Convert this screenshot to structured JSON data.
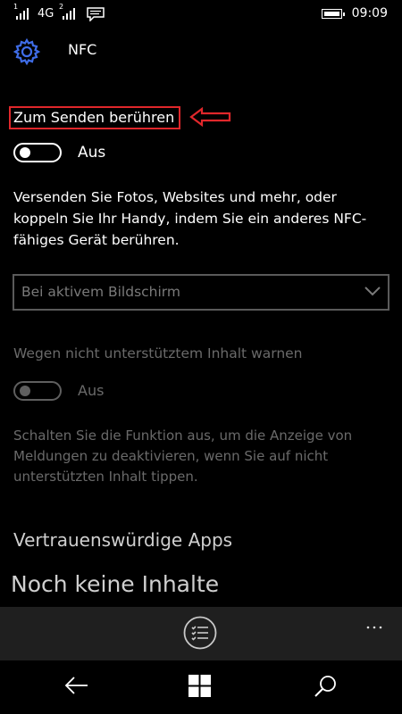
{
  "status_bar": {
    "sim1": "1",
    "network": "4G",
    "sim2": "2",
    "time": "09:09",
    "icons": [
      "signal-icon",
      "signal-icon",
      "message-icon",
      "battery-icon"
    ]
  },
  "header": {
    "title": "NFC",
    "icon": "gear-icon"
  },
  "tap_to_send": {
    "label": "Zum Senden berühren",
    "toggle_state": "Aus",
    "description": "Versenden Sie Fotos, Websites und mehr, oder koppeln Sie Ihr Handy, indem Sie ein anderes NFC-fähiges Gerät berühren.",
    "highlight_color": "#e0272b"
  },
  "dropdown": {
    "selected": "Bei aktivem Bildschirm"
  },
  "unsupported_content": {
    "label": "Wegen nicht unterstütztem Inhalt warnen",
    "toggle_state": "Aus",
    "description": "Schalten Sie die Funktion aus, um die Anzeige von Meldungen zu deaktivieren, wenn Sie auf nicht unterstützten Inhalt tippen."
  },
  "trusted_apps": {
    "heading": "Vertrauenswürdige Apps",
    "empty_text": "Noch keine Inhalte"
  },
  "app_bar": {
    "icons": [
      "checklist-icon",
      "more-icon"
    ]
  },
  "nav_bar": {
    "icons": [
      "back-icon",
      "windows-icon",
      "search-icon"
    ]
  }
}
